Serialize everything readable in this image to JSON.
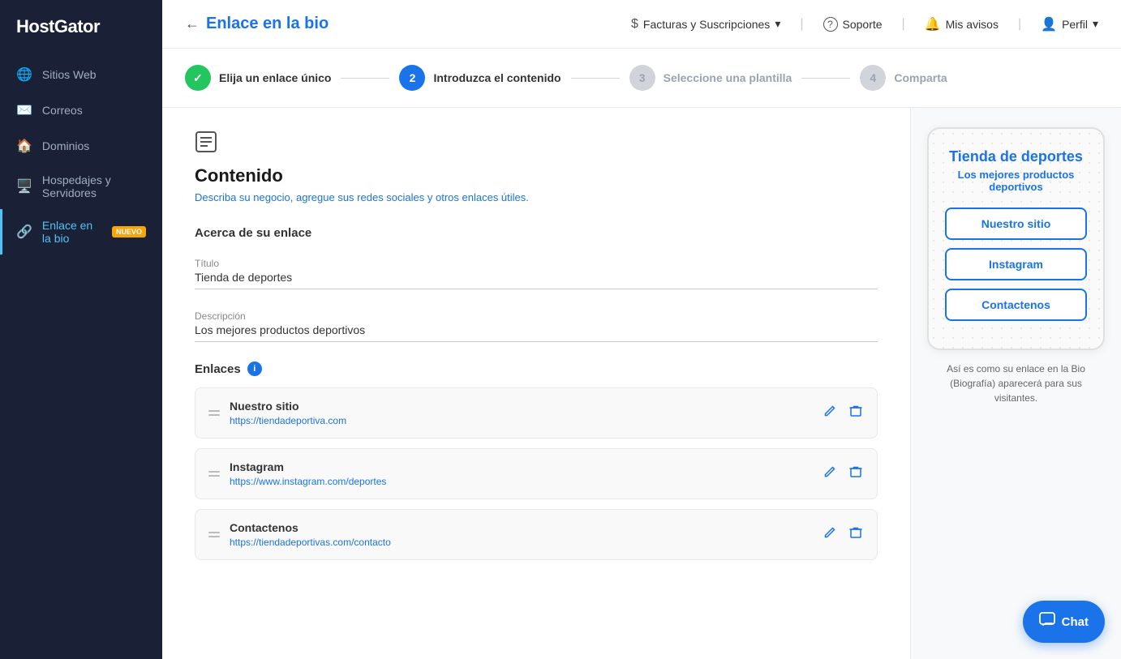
{
  "sidebar": {
    "logo": "HostGator",
    "items": [
      {
        "id": "sitios-web",
        "label": "Sitios Web",
        "icon": "🌐",
        "active": false
      },
      {
        "id": "correos",
        "label": "Correos",
        "icon": "✉️",
        "active": false
      },
      {
        "id": "dominios",
        "label": "Dominios",
        "icon": "🏠",
        "active": false
      },
      {
        "id": "hospedajes",
        "label": "Hospedajes y Servidores",
        "icon": "🖥️",
        "active": false
      },
      {
        "id": "enlace-bio",
        "label": "Enlace en la bio",
        "icon": "🔗",
        "active": true,
        "badge": "NUEVO"
      }
    ]
  },
  "header": {
    "back_arrow": "←",
    "page_title": "Enlace en la bio",
    "nav_items": [
      {
        "id": "facturas",
        "icon": "$",
        "label": "Facturas y Suscripciones",
        "has_dropdown": true
      },
      {
        "id": "soporte",
        "icon": "?",
        "label": "Soporte"
      },
      {
        "id": "avisos",
        "icon": "🔔",
        "label": "Mis avisos"
      },
      {
        "id": "perfil",
        "icon": "👤",
        "label": "Perfil",
        "has_dropdown": true
      }
    ]
  },
  "stepper": {
    "steps": [
      {
        "id": "step1",
        "number": "✓",
        "label": "Elija un enlace único",
        "state": "done"
      },
      {
        "id": "step2",
        "number": "2",
        "label": "Introduzca el contenido",
        "state": "active"
      },
      {
        "id": "step3",
        "number": "3",
        "label": "Seleccione una plantilla",
        "state": "inactive"
      },
      {
        "id": "step4",
        "number": "4",
        "label": "Comparta",
        "state": "inactive"
      }
    ]
  },
  "form": {
    "icon": "≡",
    "title": "Contenido",
    "subtitle": "Describa su negocio, agregue sus redes sociales y otros enlaces útiles.",
    "section_title": "Acerca de su enlace",
    "title_label": "Título",
    "title_value": "Tienda de deportes",
    "description_label": "Descripción",
    "description_value": "Los mejores productos deportivos",
    "links_title": "Enlaces",
    "links_info": "i",
    "links": [
      {
        "id": "link1",
        "name": "Nuestro sitio",
        "url": "https://tiendadeportiva.com"
      },
      {
        "id": "link2",
        "name": "Instagram",
        "url": "https://www.instagram.com/deportes"
      },
      {
        "id": "link3",
        "name": "Contactenos",
        "url": "https://tiendadeportivas.com/contacto"
      }
    ]
  },
  "preview": {
    "store_title": "Tienda de deportes",
    "store_subtitle": "Los mejores productos deportivos",
    "buttons": [
      {
        "id": "btn1",
        "label": "Nuestro sitio"
      },
      {
        "id": "btn2",
        "label": "Instagram"
      },
      {
        "id": "btn3",
        "label": "Contactenos"
      }
    ],
    "caption": "Así es como su enlace en la Bio (Biografía) aparecerá para sus visitantes."
  },
  "chat": {
    "label": "Chat",
    "icon": "💬"
  }
}
